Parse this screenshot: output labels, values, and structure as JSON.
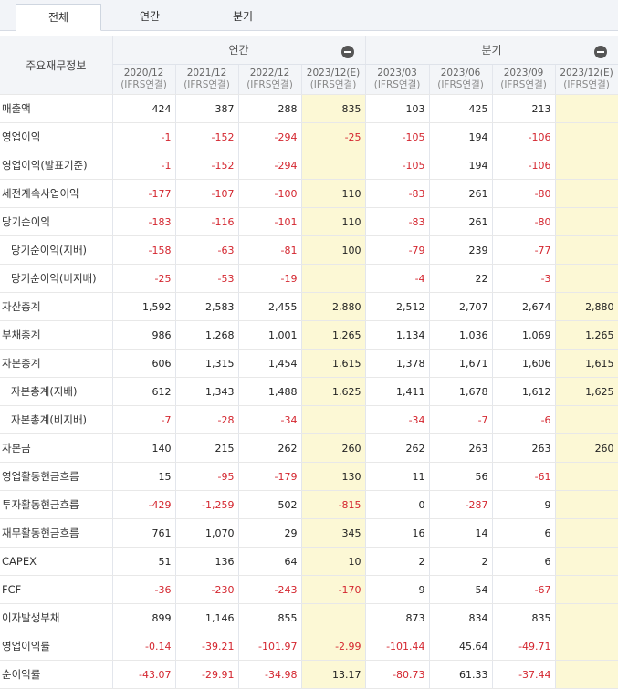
{
  "tabs": [
    {
      "label": "전체",
      "active": true
    },
    {
      "label": "연간",
      "active": false
    },
    {
      "label": "분기",
      "active": false
    }
  ],
  "header": {
    "corner": "주요재무정보",
    "group_annual": "연간",
    "group_quarter": "분기",
    "periods": [
      {
        "date": "2020/12",
        "basis": "(IFRS연결)"
      },
      {
        "date": "2021/12",
        "basis": "(IFRS연결)"
      },
      {
        "date": "2022/12",
        "basis": "(IFRS연결)"
      },
      {
        "date": "2023/12(E)",
        "basis": "(IFRS연결)"
      },
      {
        "date": "2023/03",
        "basis": "(IFRS연결)"
      },
      {
        "date": "2023/06",
        "basis": "(IFRS연결)"
      },
      {
        "date": "2023/09",
        "basis": "(IFRS연결)"
      },
      {
        "date": "2023/12(E)",
        "basis": "(IFRS연결)"
      }
    ]
  },
  "rows": [
    {
      "label": "매출액",
      "indent": false,
      "values": [
        "424",
        "387",
        "288",
        "835",
        "103",
        "425",
        "213",
        ""
      ]
    },
    {
      "label": "영업이익",
      "indent": false,
      "values": [
        "-1",
        "-152",
        "-294",
        "-25",
        "-105",
        "194",
        "-106",
        ""
      ]
    },
    {
      "label": "영업이익(발표기준)",
      "indent": false,
      "values": [
        "-1",
        "-152",
        "-294",
        "",
        "-105",
        "194",
        "-106",
        ""
      ]
    },
    {
      "label": "세전계속사업이익",
      "indent": false,
      "values": [
        "-177",
        "-107",
        "-100",
        "110",
        "-83",
        "261",
        "-80",
        ""
      ]
    },
    {
      "label": "당기순이익",
      "indent": false,
      "values": [
        "-183",
        "-116",
        "-101",
        "110",
        "-83",
        "261",
        "-80",
        ""
      ]
    },
    {
      "label": "당기순이익(지배)",
      "indent": true,
      "values": [
        "-158",
        "-63",
        "-81",
        "100",
        "-79",
        "239",
        "-77",
        ""
      ]
    },
    {
      "label": "당기순이익(비지배)",
      "indent": true,
      "values": [
        "-25",
        "-53",
        "-19",
        "",
        "-4",
        "22",
        "-3",
        ""
      ]
    },
    {
      "label": "자산총계",
      "indent": false,
      "values": [
        "1,592",
        "2,583",
        "2,455",
        "2,880",
        "2,512",
        "2,707",
        "2,674",
        "2,880"
      ]
    },
    {
      "label": "부채총계",
      "indent": false,
      "values": [
        "986",
        "1,268",
        "1,001",
        "1,265",
        "1,134",
        "1,036",
        "1,069",
        "1,265"
      ]
    },
    {
      "label": "자본총계",
      "indent": false,
      "values": [
        "606",
        "1,315",
        "1,454",
        "1,615",
        "1,378",
        "1,671",
        "1,606",
        "1,615"
      ]
    },
    {
      "label": "자본총계(지배)",
      "indent": true,
      "values": [
        "612",
        "1,343",
        "1,488",
        "1,625",
        "1,411",
        "1,678",
        "1,612",
        "1,625"
      ]
    },
    {
      "label": "자본총계(비지배)",
      "indent": true,
      "values": [
        "-7",
        "-28",
        "-34",
        "",
        "-34",
        "-7",
        "-6",
        ""
      ]
    },
    {
      "label": "자본금",
      "indent": false,
      "values": [
        "140",
        "215",
        "262",
        "260",
        "262",
        "263",
        "263",
        "260"
      ]
    },
    {
      "label": "영업활동현금흐름",
      "indent": false,
      "values": [
        "15",
        "-95",
        "-179",
        "130",
        "11",
        "56",
        "-61",
        ""
      ]
    },
    {
      "label": "투자활동현금흐름",
      "indent": false,
      "values": [
        "-429",
        "-1,259",
        "502",
        "-815",
        "0",
        "-287",
        "9",
        ""
      ]
    },
    {
      "label": "재무활동현금흐름",
      "indent": false,
      "values": [
        "761",
        "1,070",
        "29",
        "345",
        "16",
        "14",
        "6",
        ""
      ]
    },
    {
      "label": "CAPEX",
      "indent": false,
      "values": [
        "51",
        "136",
        "64",
        "10",
        "2",
        "2",
        "6",
        ""
      ]
    },
    {
      "label": "FCF",
      "indent": false,
      "values": [
        "-36",
        "-230",
        "-243",
        "-170",
        "9",
        "54",
        "-67",
        ""
      ]
    },
    {
      "label": "이자발생부채",
      "indent": false,
      "values": [
        "899",
        "1,146",
        "855",
        "",
        "873",
        "834",
        "835",
        ""
      ]
    },
    {
      "label": "영업이익률",
      "indent": false,
      "values": [
        "-0.14",
        "-39.21",
        "-101.97",
        "-2.99",
        "-101.44",
        "45.64",
        "-49.71",
        ""
      ]
    },
    {
      "label": "순이익률",
      "indent": false,
      "values": [
        "-43.07",
        "-29.91",
        "-34.98",
        "13.17",
        "-80.73",
        "61.33",
        "-37.44",
        ""
      ]
    }
  ],
  "colors": {
    "negative": "#d4262f",
    "estimate_bg": "#fcf8d5"
  }
}
